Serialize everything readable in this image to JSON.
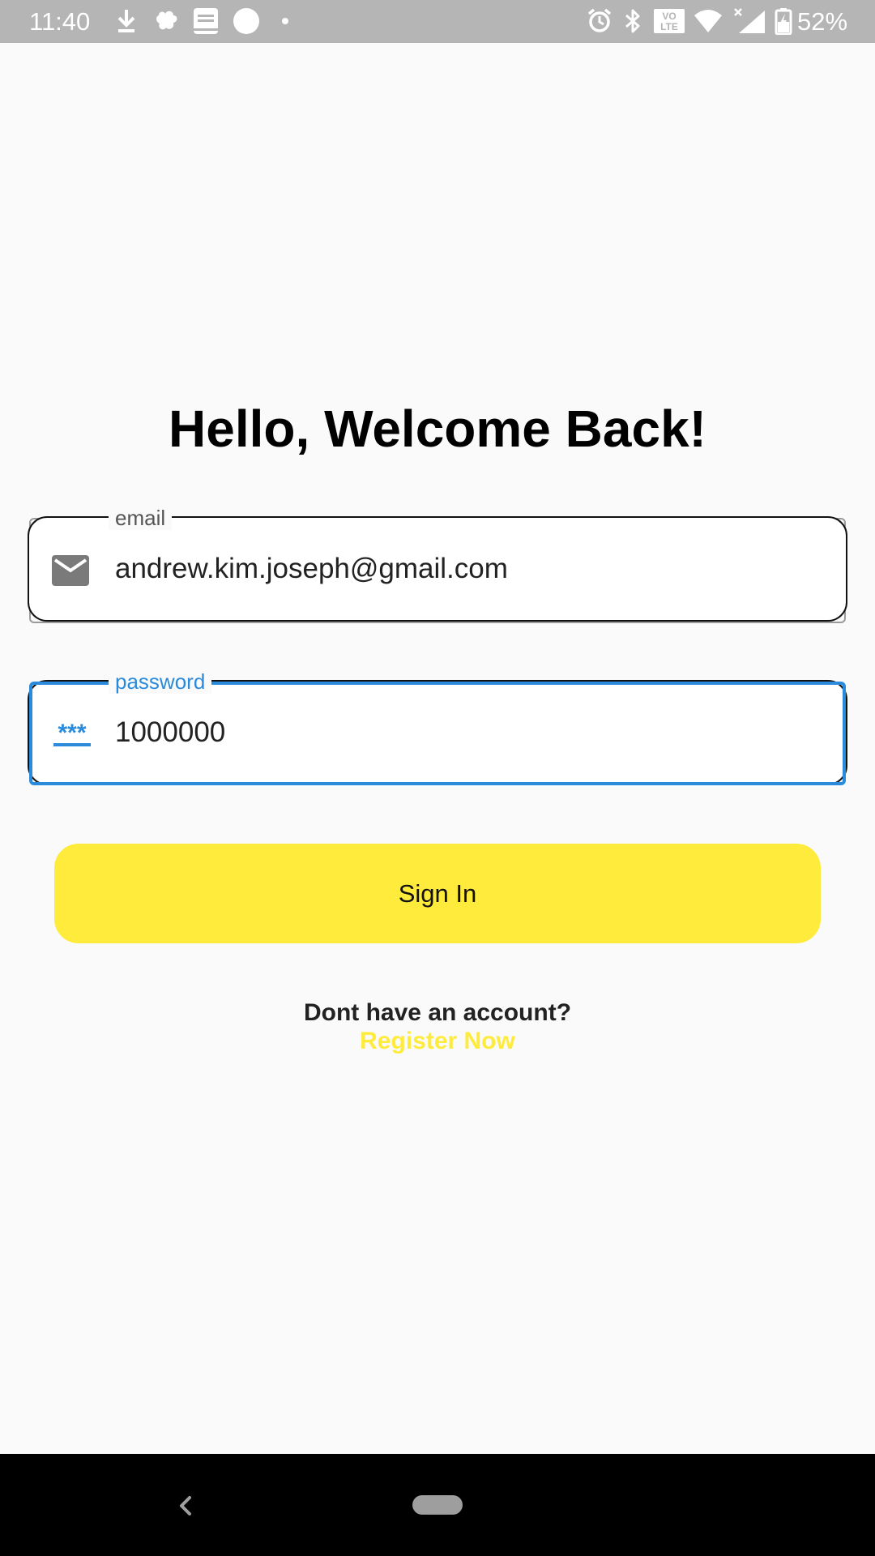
{
  "status_bar": {
    "time": "11:40",
    "battery": "52%",
    "icons": [
      "download-icon",
      "notification-app-icon",
      "bible-app-icon",
      "circle-notification-icon",
      "dot-icon",
      "alarm-icon",
      "bluetooth-icon",
      "volte-icon",
      "wifi-icon",
      "cell-signal-icon",
      "battery-charging-icon"
    ],
    "volte_label_top": "VO",
    "volte_label_bottom": "LTE"
  },
  "login": {
    "title": "Hello, Welcome Back!",
    "email": {
      "label": "email",
      "value": "andrew.kim.joseph@gmail.com",
      "icon": "mail-icon"
    },
    "password": {
      "label": "password",
      "value": "1000000",
      "icon": "password-icon",
      "icon_text": "***"
    },
    "sign_in_label": "Sign In",
    "register_prompt": "Dont have an account?",
    "register_link": "Register Now"
  },
  "colors": {
    "background": "#fafafa",
    "accent_yellow": "#ffeb3b",
    "focus_blue": "#2a8bdc",
    "status_bar": "#b5b5b5",
    "nav_bar": "#000000"
  },
  "nav_bar": {
    "icons": [
      "back-icon",
      "home-pill-icon"
    ]
  }
}
